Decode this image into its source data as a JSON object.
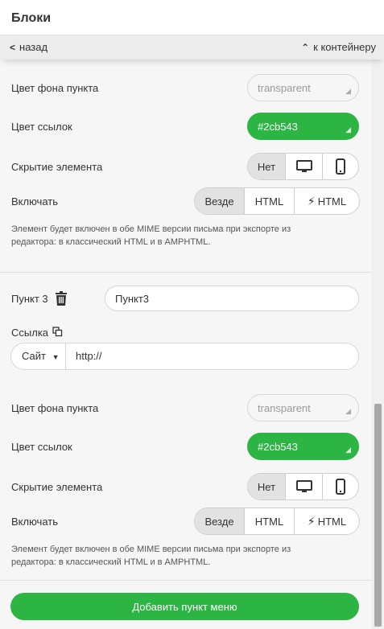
{
  "header": {
    "title": "Блоки"
  },
  "nav": {
    "back_label": "назад",
    "up_label": "к контейнеру"
  },
  "colors": {
    "accent": "#2cb543",
    "segment_active": "#e2e2e2"
  },
  "item2": {
    "bg_color_label": "Цвет фона пункта",
    "bg_color_value": "transparent",
    "link_color_label": "Цвет ссылок",
    "link_color_value": "#2cb543",
    "hide_label": "Скрытие элемента",
    "hide_options": [
      "Нет",
      "desktop-icon",
      "mobile-icon"
    ],
    "hide_selected": "Нет",
    "include_label": "Включать",
    "include_options": [
      "Везде",
      "HTML",
      "HTML"
    ],
    "include_selected": "Везде",
    "help_line1": "Элемент будет включен в обе MIME версии письма при экспорте из",
    "help_line2": "редактора: в классический HTML и в AMPHTML."
  },
  "item3": {
    "label": "Пункт 3",
    "name_value": "Пункт3",
    "link_label": "Ссылка",
    "link_type": "Сайт",
    "link_value": "http://",
    "bg_color_label": "Цвет фона пункта",
    "bg_color_value": "transparent",
    "link_color_label": "Цвет ссылок",
    "link_color_value": "#2cb543",
    "hide_label": "Скрытие элемента",
    "hide_options": [
      "Нет",
      "desktop-icon",
      "mobile-icon"
    ],
    "hide_selected": "Нет",
    "include_label": "Включать",
    "include_options": [
      "Везде",
      "HTML",
      "HTML"
    ],
    "include_selected": "Везде",
    "help_line1": "Элемент будет включен в обе MIME версии письма при экспорте из",
    "help_line2": "редактора: в классический HTML и в AMPHTML."
  },
  "add_button_label": "Добавить пункт меню"
}
